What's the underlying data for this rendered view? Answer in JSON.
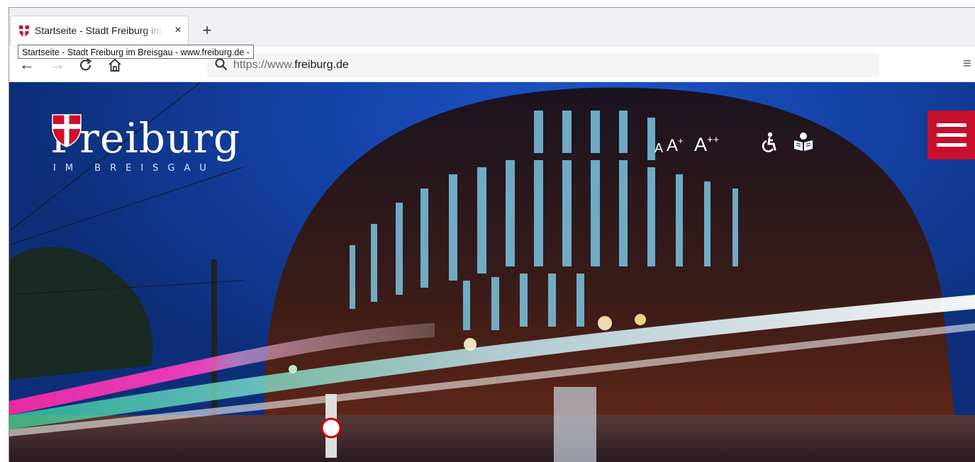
{
  "browser": {
    "tab": {
      "title": "Startseite - Stadt Freiburg im Breisgau - www.freiburg.de -",
      "favicon": "freiburg-shield-icon",
      "close_glyph": "×"
    },
    "new_tab_glyph": "+",
    "tooltip": "Startseite - Stadt Freiburg im Breisgau - www.freiburg.de -",
    "nav": {
      "back_glyph": "←",
      "forward_glyph": "→",
      "reload_glyph": "C",
      "home_icon": "home-icon"
    },
    "url": {
      "scheme": "https://www.",
      "host": "freiburg.de",
      "search_icon": "search-icon"
    },
    "menu_glyph": "≡"
  },
  "page": {
    "brand": {
      "name": "Freiburg",
      "subtitle": "IM BREISGAU"
    },
    "accessibility": {
      "font_small": "A",
      "font_medium": "A",
      "font_medium_sup": "+",
      "font_large": "A",
      "font_large_sup": "++",
      "accessibility_icon": "wheelchair-icon",
      "easy_language_icon": "easy-reading-icon"
    },
    "menu_button_icon": "hamburger-menu-icon",
    "colors": {
      "brand_red": "#c8102e",
      "sky_blue": "#1443a8"
    }
  }
}
